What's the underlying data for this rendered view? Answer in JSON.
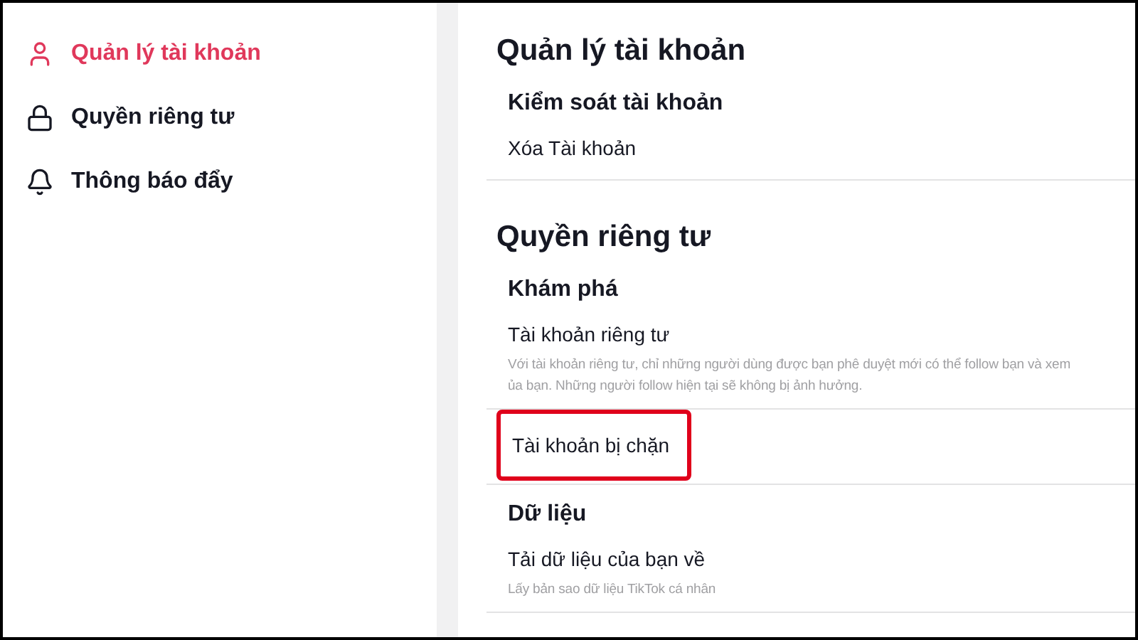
{
  "sidebar": {
    "items": [
      {
        "label": "Quản lý tài khoản",
        "kind": "user",
        "selected": true
      },
      {
        "label": "Quyền riêng tư",
        "kind": "lock",
        "selected": false
      },
      {
        "label": "Thông báo đẩy",
        "kind": "bell",
        "selected": false
      }
    ]
  },
  "sections": [
    {
      "title": "Quản lý tài khoản",
      "groups": [
        {
          "title": "Kiểm soát tài khoản",
          "items": [
            {
              "label": "Xóa Tài khoản",
              "highlighted": false
            }
          ]
        }
      ]
    },
    {
      "title": "Quyền riêng tư",
      "groups": [
        {
          "title": "Khám phá",
          "items": [
            {
              "label": "Tài khoản riêng tư",
              "description": [
                "Với tài khoản riêng tư, chỉ những người dùng được bạn phê duyệt mới có thể follow bạn và xem",
                "ủa bạn. Những người follow hiện tại sẽ không bị ảnh hưởng."
              ],
              "highlighted": false
            },
            {
              "label": "Tài khoản bị chặn",
              "highlighted": true
            }
          ]
        },
        {
          "title": "Dữ liệu",
          "items": [
            {
              "label": "Tải dữ liệu của bạn về",
              "description": [
                "Lấy bản sao dữ liệu TikTok cá nhân"
              ],
              "highlighted": false
            }
          ]
        }
      ]
    }
  ]
}
